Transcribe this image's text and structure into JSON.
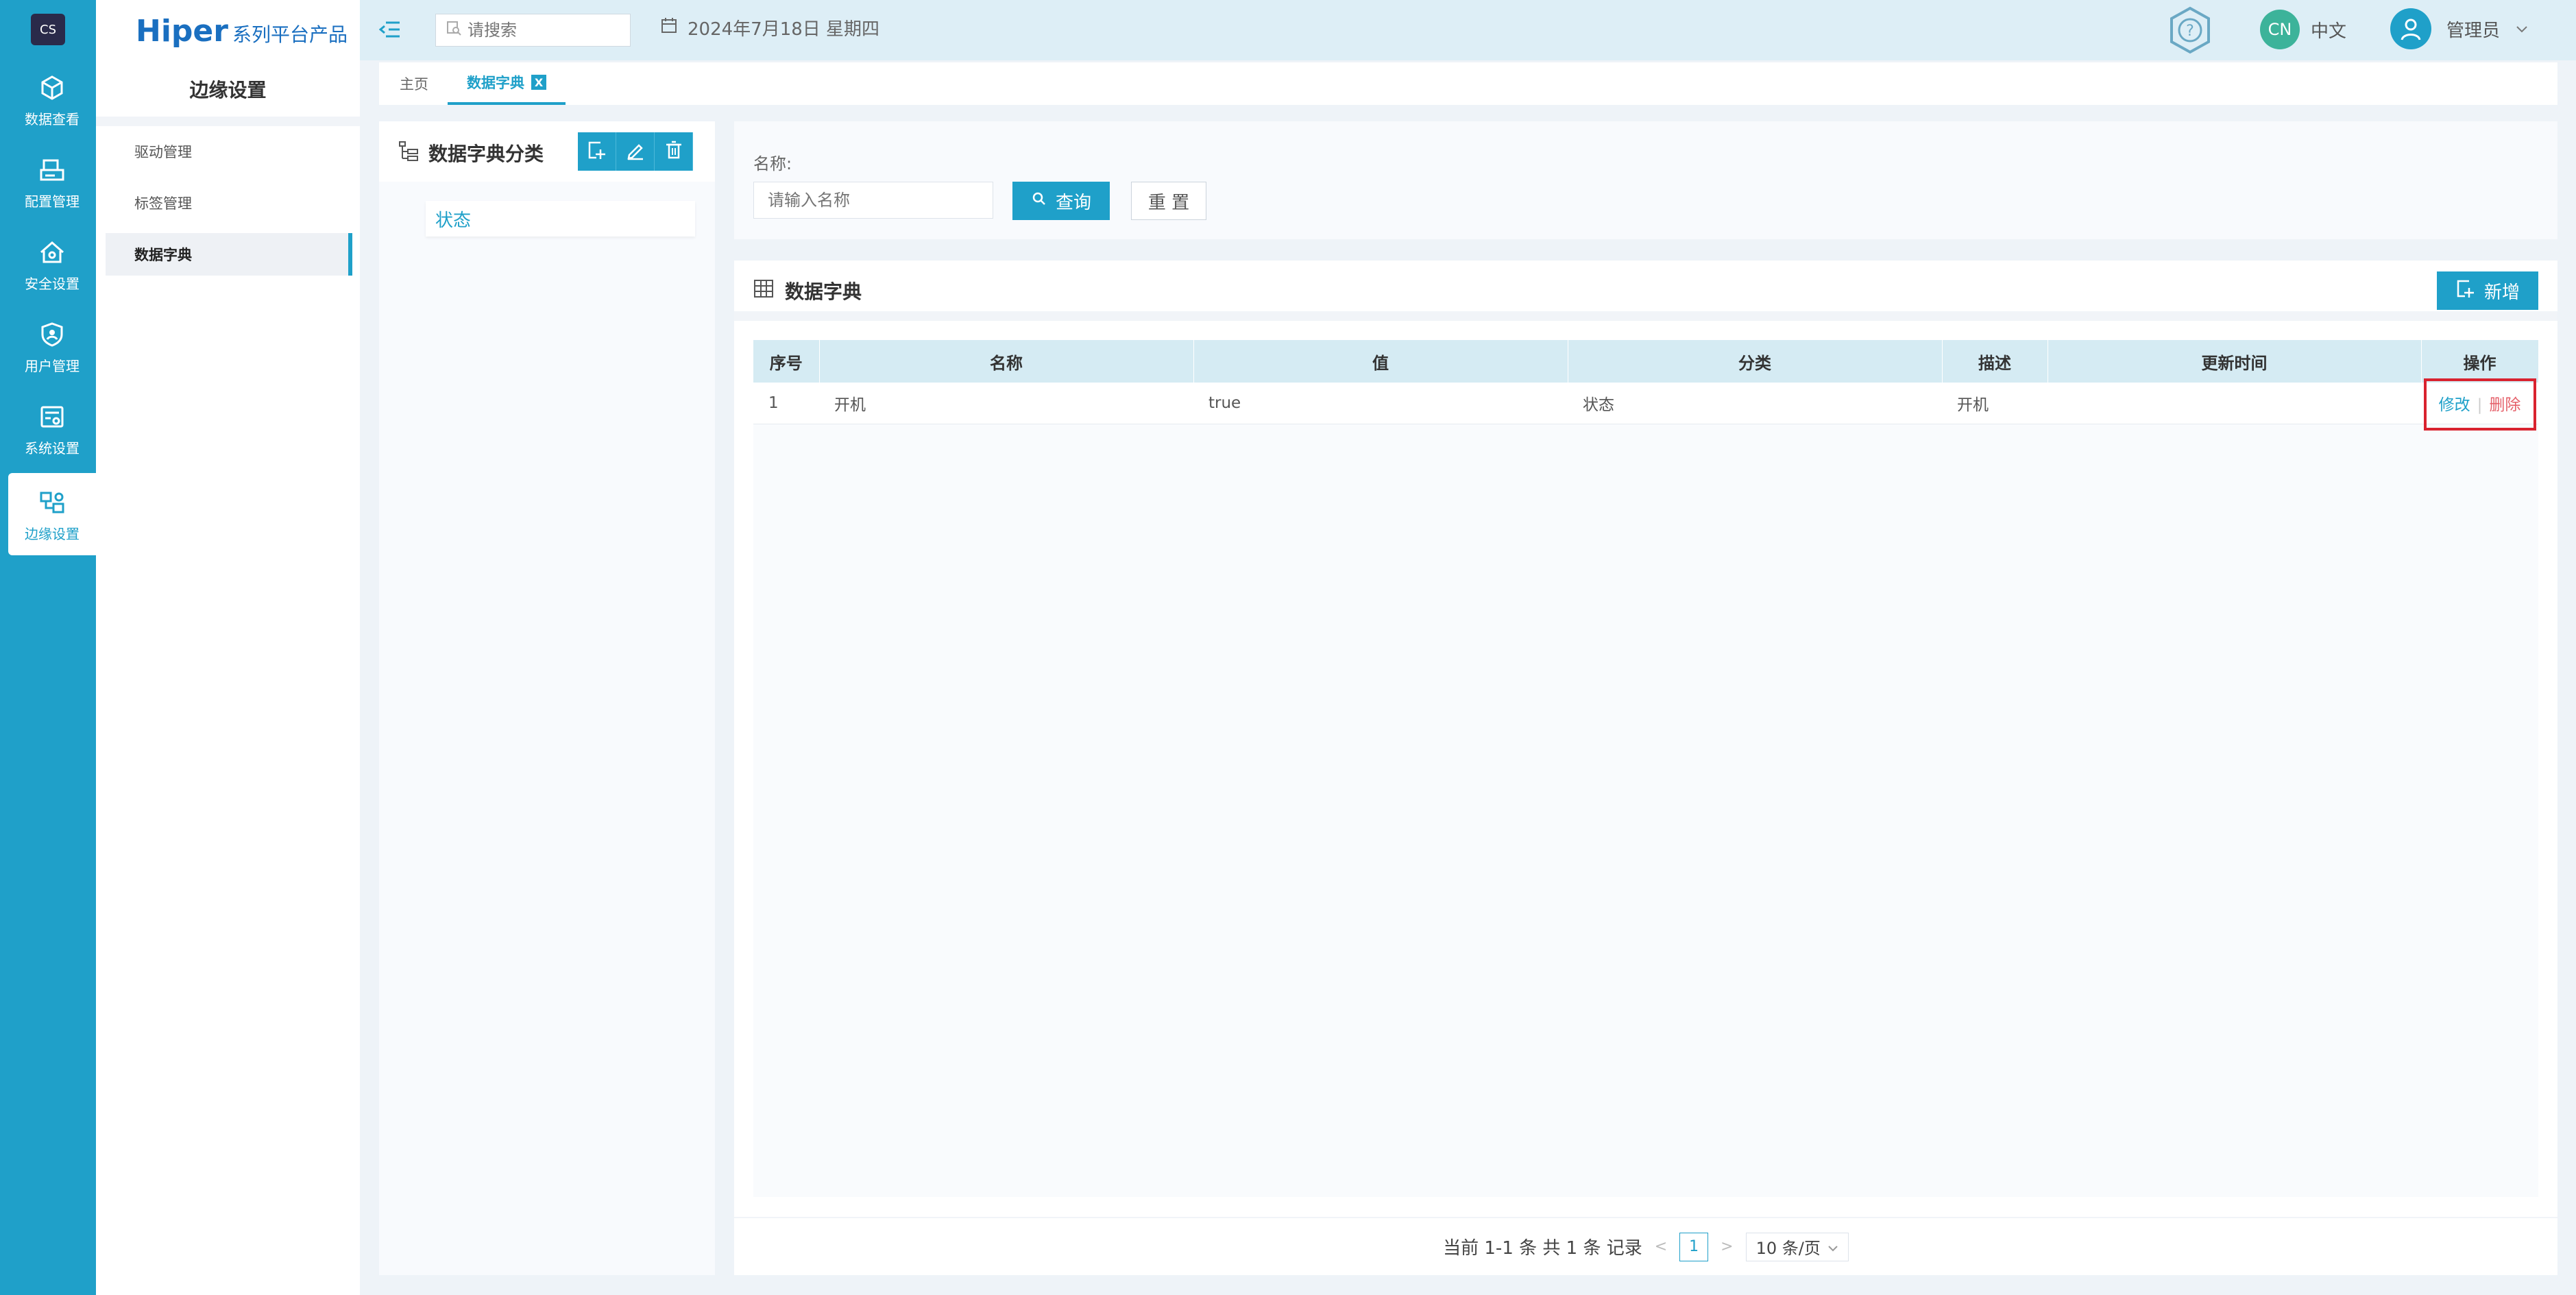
{
  "rail": {
    "logo": "CS",
    "items": [
      {
        "label": "数据查看",
        "icon": "cube-icon"
      },
      {
        "label": "配置管理",
        "icon": "printer-config-icon"
      },
      {
        "label": "安全设置",
        "icon": "house-shield-icon"
      },
      {
        "label": "用户管理",
        "icon": "user-shield-icon"
      },
      {
        "label": "系统设置",
        "icon": "system-settings-icon"
      },
      {
        "label": "边缘设置",
        "icon": "edge-network-icon"
      }
    ],
    "active_index": 5
  },
  "brand": {
    "name": "Hiper",
    "suffix": "系列平台产品"
  },
  "subsidebar": {
    "title": "边缘设置",
    "items": [
      "驱动管理",
      "标签管理",
      "数据字典"
    ],
    "active_index": 2
  },
  "topbar": {
    "search_placeholder": "请搜索",
    "date": "2024年7月18日 星期四",
    "lang_code": "CN",
    "lang_label": "中文",
    "user": "管理员"
  },
  "tabs": {
    "home": "主页",
    "current": "数据字典",
    "close": "X"
  },
  "category_panel": {
    "title": "数据字典分类",
    "tree_items": [
      "状态"
    ]
  },
  "filter": {
    "name_label": "名称:",
    "name_placeholder": "请输入名称",
    "query_label": "查询",
    "reset_label": "重 置"
  },
  "data_panel": {
    "title": "数据字典",
    "add_label": "新增",
    "columns": [
      "序号",
      "名称",
      "值",
      "分类",
      "描述",
      "更新时间",
      "操作"
    ],
    "rows": [
      {
        "index": "1",
        "name": "开机",
        "value": "true",
        "category": "状态",
        "desc": "开机",
        "updated": "",
        "edit": "修改",
        "del": "删除",
        "sep": "|"
      }
    ]
  },
  "pagination": {
    "summary": "当前 1-1 条 共 1 条 记录",
    "current_page": "1",
    "page_size": "10 条/页"
  },
  "colors": {
    "accent": "#1fa0c9",
    "danger": "#e5606a",
    "highlight": "#d9232f"
  }
}
